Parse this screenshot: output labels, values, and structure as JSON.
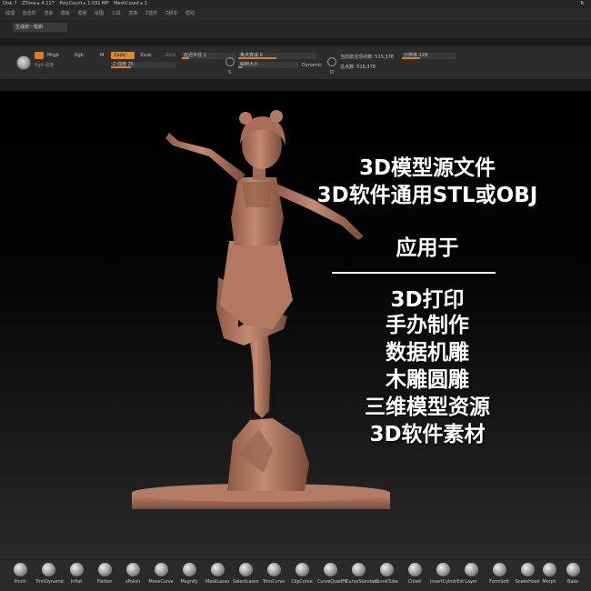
{
  "status_bar": {
    "items": [
      "Disk 7",
      "ZTime ▸ 4.117",
      "PolyCount ▸ 1.031 MP",
      "MeshCount ▸ 1"
    ],
    "corner": "R"
  },
  "menu": {
    "items": [
      "纹理",
      "首选项",
      "渲染",
      "模板",
      "笔刷",
      "绘图",
      "工具",
      "变换",
      "Z插件",
      "Z脚本",
      "帮助"
    ]
  },
  "preset": {
    "label": "生成统一笔刷"
  },
  "shelf": {
    "tool_icon": "sphere-brush-icon",
    "m_label": "M",
    "mrgb_label": "Mrgb",
    "rgb_label": "Rgb",
    "rgb_sub": "Rgb 强度",
    "zadd_label": "Zadd",
    "zsub_label": "Zsub",
    "zcut_label": "Zcut",
    "z_intensity": "Z 强度 25",
    "focal_shift": "焦点衰减 0",
    "draw_size": "绘制大小",
    "dynamic": "Dynamic",
    "focal_radius": "延迟半径 1",
    "active_points": "当前激活顶点数: 515,378",
    "total_points": "总点数: 515,378",
    "resolution": "分辨率 128",
    "s_label": "S",
    "d_label": "D",
    "accent_color": "#e07a1f"
  },
  "overlay": {
    "lines_top": [
      "3D模型源文件",
      "3D软件通用STL或OBJ"
    ],
    "apply_title": "应用于",
    "lines_bottom": [
      "3D打印",
      "手办制作",
      "数据机雕",
      "木雕圆雕",
      "三维模型资源",
      "3D软件素材"
    ]
  },
  "brushes": [
    "Pinch",
    "TrimDynamic",
    "Inflat",
    "Flatten",
    "sPolish",
    "MoveCurve",
    "Magnify",
    "MaskLasso",
    "SelectLasso",
    "TrimCurve",
    "ClipCurve",
    "CurveQuadFill",
    "CurveStandard",
    "CurveTube",
    "Chisel",
    "InsertCylndrExt",
    "Layer",
    "FormSoft",
    "SnakeHook",
    "Morph",
    "Bake"
  ]
}
